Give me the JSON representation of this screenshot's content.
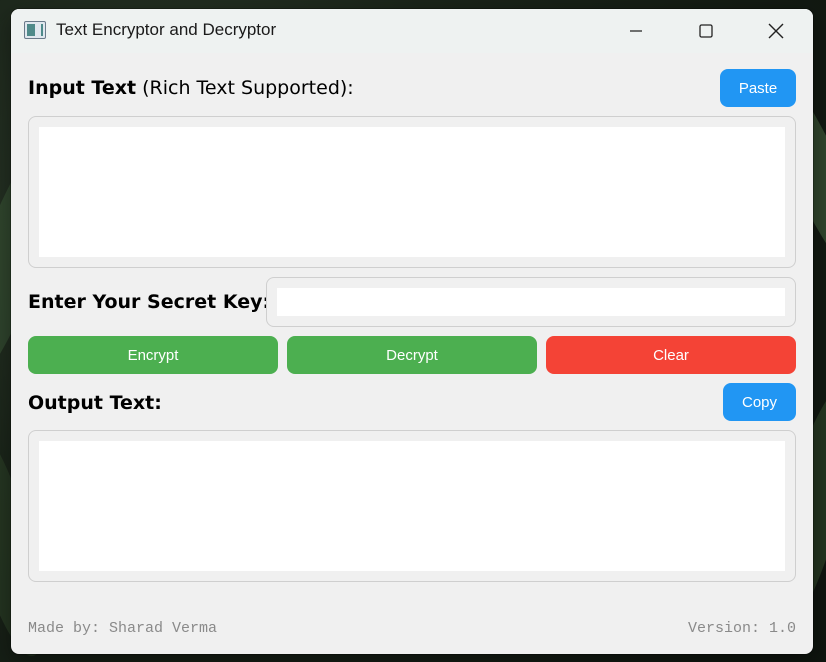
{
  "window": {
    "title": "Text Encryptor and Decryptor"
  },
  "input_section": {
    "label_bold": "Input Text",
    "label_rest": " (Rich Text Supported):",
    "paste_label": "Paste",
    "value": ""
  },
  "key_section": {
    "label": "Enter Your Secret Key:",
    "value": ""
  },
  "actions": {
    "encrypt_label": "Encrypt",
    "decrypt_label": "Decrypt",
    "clear_label": "Clear"
  },
  "output_section": {
    "label": "Output Text:",
    "copy_label": "Copy",
    "value": ""
  },
  "footer": {
    "author": "Made by: Sharad Verma",
    "version": "Version: 1.0"
  },
  "colors": {
    "blue": "#2196f3",
    "green": "#4caf50",
    "red": "#f44336"
  },
  "icons": {
    "app": "app-window-icon",
    "minimize": "minimize-icon",
    "maximize": "maximize-icon",
    "close": "close-icon"
  }
}
